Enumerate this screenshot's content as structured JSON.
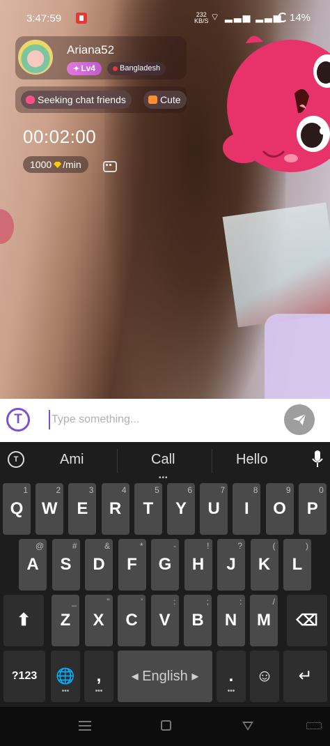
{
  "status_bar": {
    "time": "3:47:59",
    "net_speed_top": "232",
    "net_speed_bottom": "KB/S",
    "signal_icons": "⌔ ▂▃▅ ▂▃▅",
    "battery": "14%"
  },
  "profile": {
    "username": "Ariana52",
    "level": "Lv4",
    "country": "Bangladesh"
  },
  "tags": [
    {
      "label": "Seeking chat friends"
    },
    {
      "label": "Cute"
    }
  ],
  "call": {
    "timer": "00:02:00",
    "rate_amount": "1000",
    "rate_unit": "/min"
  },
  "input": {
    "placeholder": "Type something...",
    "logo_letter": "T"
  },
  "keyboard": {
    "suggestions": [
      "Ami",
      "Call",
      "Hello"
    ],
    "tools_icon_letter": "T",
    "row1": [
      {
        "k": "Q",
        "h": "1"
      },
      {
        "k": "W",
        "h": "2"
      },
      {
        "k": "E",
        "h": "3"
      },
      {
        "k": "R",
        "h": "4"
      },
      {
        "k": "T",
        "h": "5"
      },
      {
        "k": "Y",
        "h": "6"
      },
      {
        "k": "U",
        "h": "7"
      },
      {
        "k": "I",
        "h": "8"
      },
      {
        "k": "O",
        "h": "9"
      },
      {
        "k": "P",
        "h": "0"
      }
    ],
    "row2": [
      {
        "k": "A",
        "h": "@"
      },
      {
        "k": "S",
        "h": "#"
      },
      {
        "k": "D",
        "h": "&"
      },
      {
        "k": "F",
        "h": "*"
      },
      {
        "k": "G",
        "h": "-"
      },
      {
        "k": "H",
        "h": "!"
      },
      {
        "k": "J",
        "h": "?"
      },
      {
        "k": "K",
        "h": "("
      },
      {
        "k": "L",
        "h": ")"
      }
    ],
    "row3": [
      {
        "k": "Z",
        "h": "_"
      },
      {
        "k": "X",
        "h": "\""
      },
      {
        "k": "C",
        "h": "'"
      },
      {
        "k": "V",
        "h": ":"
      },
      {
        "k": "B",
        "h": ";"
      },
      {
        "k": "N",
        "h": ":"
      },
      {
        "k": "M",
        "h": "/"
      }
    ],
    "shift_icon": "⬆",
    "backspace_icon": "⌫",
    "symbols_label": "?123",
    "globe_icon": "🌐",
    "comma": ",",
    "space_label": "◂ English ▸",
    "period": ".",
    "emoji_icon": "☺",
    "enter_icon": "↵"
  }
}
